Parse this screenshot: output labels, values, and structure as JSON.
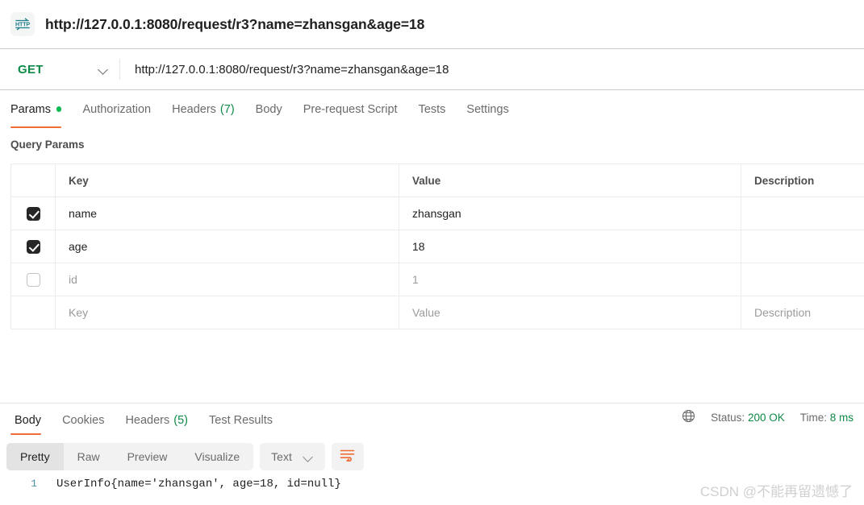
{
  "titlebar": {
    "icon": "http-protocol-icon",
    "title": "http://127.0.0.1:8080/request/r3?name=zhansgan&age=18"
  },
  "urlbar": {
    "method": "GET",
    "method_chevron": "chevron-down-icon",
    "url": "http://127.0.0.1:8080/request/r3?name=zhansgan&age=18"
  },
  "request_tabs": [
    {
      "label": "Params",
      "active": true,
      "dot": true
    },
    {
      "label": "Authorization",
      "active": false
    },
    {
      "label": "Headers",
      "count": "(7)",
      "active": false
    },
    {
      "label": "Body",
      "active": false
    },
    {
      "label": "Pre-request Script",
      "active": false
    },
    {
      "label": "Tests",
      "active": false
    },
    {
      "label": "Settings",
      "active": false
    }
  ],
  "query_params": {
    "section_label": "Query Params",
    "headers": {
      "key": "Key",
      "value": "Value",
      "description": "Description"
    },
    "rows": [
      {
        "checked": true,
        "key": "name",
        "value": "zhansgan",
        "description": "",
        "placeholder": false
      },
      {
        "checked": true,
        "key": "age",
        "value": "18",
        "description": "",
        "placeholder": false
      },
      {
        "checked": false,
        "key": "id",
        "value": "1",
        "description": "",
        "placeholder": false
      },
      {
        "checked": null,
        "key": "Key",
        "value": "Value",
        "description": "Description",
        "placeholder": true
      }
    ]
  },
  "response": {
    "tabs": [
      {
        "label": "Body",
        "active": true
      },
      {
        "label": "Cookies",
        "active": false
      },
      {
        "label": "Headers",
        "count": "(5)",
        "active": false
      },
      {
        "label": "Test Results",
        "active": false
      }
    ],
    "meta": {
      "globe_icon": "globe-icon",
      "status_label": "Status:",
      "status_value": "200 OK",
      "time_label": "Time:",
      "time_value": "8 ms"
    },
    "toolbar": {
      "views": [
        {
          "label": "Pretty",
          "active": true
        },
        {
          "label": "Raw",
          "active": false
        },
        {
          "label": "Preview",
          "active": false
        },
        {
          "label": "Visualize",
          "active": false
        }
      ],
      "format": "Text",
      "format_chevron": "chevron-down-icon",
      "wrap_icon": "word-wrap-icon"
    },
    "body": {
      "line_number": "1",
      "text": "UserInfo{name='zhansgan', age=18, id=null}"
    }
  },
  "watermark": "CSDN @不能再留遗憾了",
  "colors": {
    "accent_orange": "#ef6c35",
    "green": "#0d8a45",
    "dot_green": "#0cbb52",
    "teal_icon": "#1f7f8c",
    "text_primary": "#212121",
    "text_muted": "#6b6b6b",
    "placeholder": "#9b9b9b",
    "border": "#ececec"
  }
}
